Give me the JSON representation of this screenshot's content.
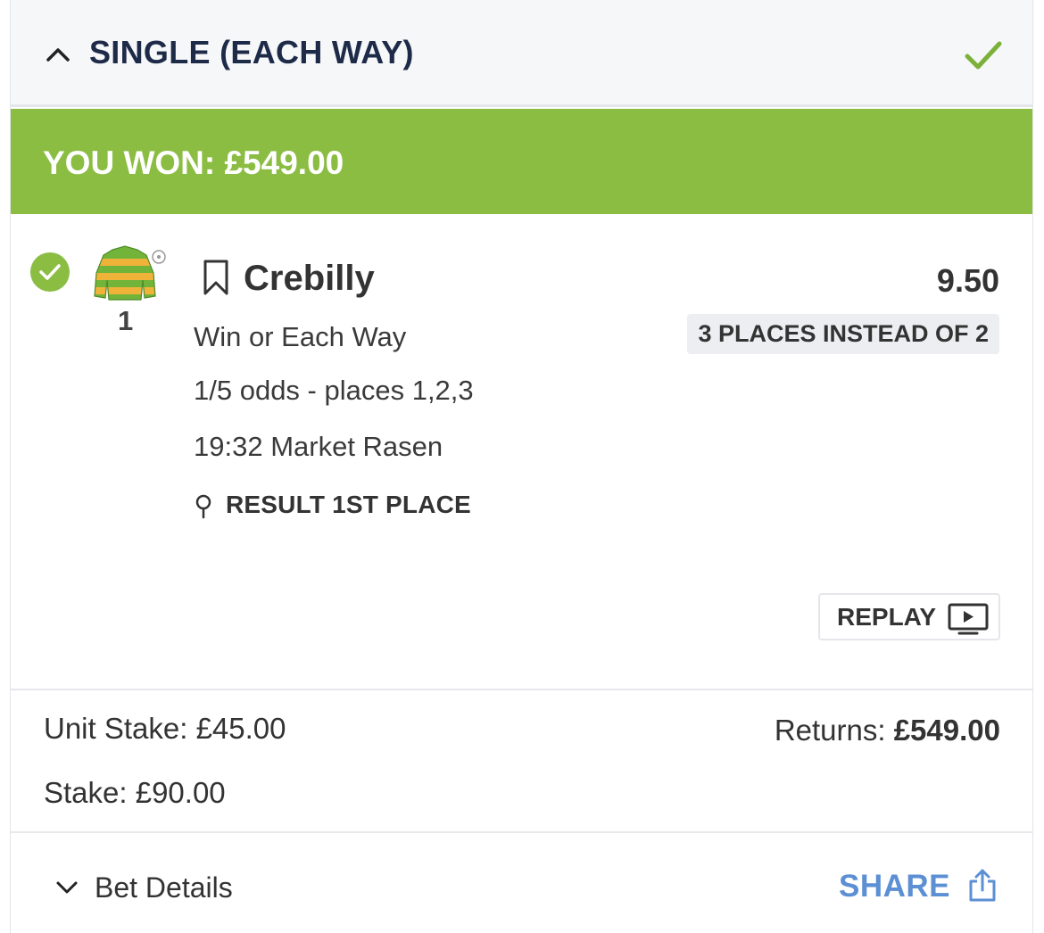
{
  "header": {
    "bet_type": "SINGLE (EACH WAY)",
    "collapse_icon": "chevron-up-icon",
    "status_icon": "check-icon"
  },
  "banner": {
    "text": "YOU WON: £549.00",
    "color": "#8bbd43"
  },
  "selection": {
    "status_icon": "check-circle-icon",
    "silks_icon": "jockey-silks-icon",
    "runner_number": "1",
    "horse_name": "Crebilly",
    "odds": "9.50",
    "promo": "3 PLACES INSTEAD OF 2",
    "market": "Win or Each Way",
    "ew_terms": "1/5 odds - places 1,2,3",
    "event": "19:32 Market Rasen",
    "result": "RESULT 1ST PLACE",
    "replay_label": "REPLAY"
  },
  "stakes": {
    "unit_stake": "Unit Stake: £45.00",
    "stake": "Stake: £90.00",
    "returns_label": "Returns:",
    "returns_value": "£549.00"
  },
  "footer": {
    "details_label": "Bet Details",
    "share_label": "SHARE",
    "share_color": "#5c8fd3"
  }
}
